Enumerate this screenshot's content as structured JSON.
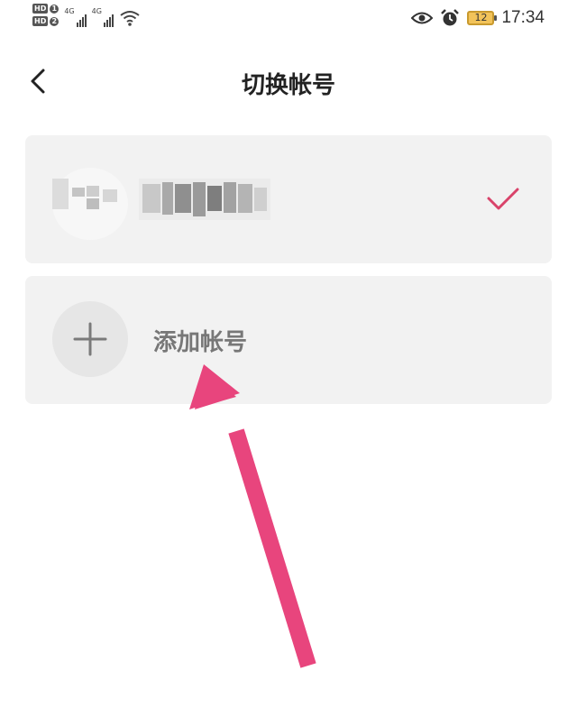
{
  "status_bar": {
    "sim1": "HD",
    "sim1_num": "1",
    "sim2": "HD",
    "sim2_num": "2",
    "network1": "4G",
    "network2": "4G",
    "battery_level": "12",
    "time": "17:34"
  },
  "header": {
    "title": "切换帐号"
  },
  "accounts": {
    "current_selected": true
  },
  "add_account": {
    "label": "添加帐号"
  },
  "colors": {
    "check": "#d9436a",
    "arrow": "#e8457d",
    "card_bg": "#f2f2f2"
  },
  "icons": {
    "back": "chevron-left-icon",
    "check": "checkmark-icon",
    "add": "plus-icon"
  }
}
